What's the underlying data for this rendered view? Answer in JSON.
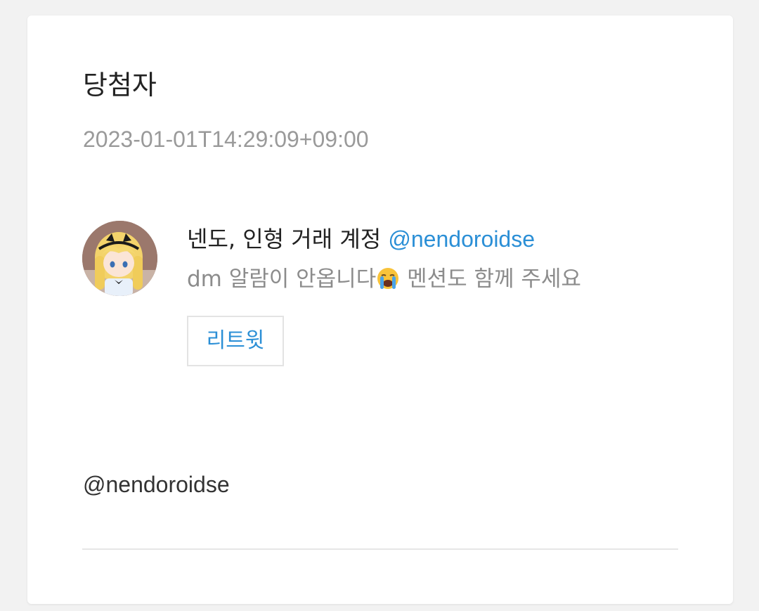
{
  "card": {
    "title": "당첨자",
    "timestamp": "2023-01-01T14:29:09+09:00"
  },
  "tweet": {
    "display_name": "넨도, 인형 거래 계정",
    "handle": "@nendoroidse",
    "text_before_emoji": "dm 알람이 안옵니다",
    "emoji": "loudly-crying-face-icon",
    "text_after_emoji": " 멘션도 함께 주세요",
    "retweet_label": "리트윗"
  },
  "winner": {
    "handle": "@nendoroidse"
  },
  "colors": {
    "background": "#f2f2f2",
    "card": "#ffffff",
    "accent": "#2b8fd6",
    "muted_text": "#9a9a9a",
    "primary_text": "#222222"
  }
}
